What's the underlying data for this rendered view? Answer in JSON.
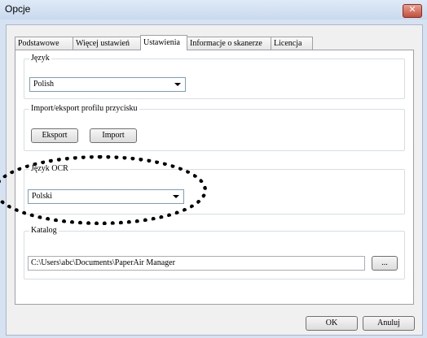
{
  "window": {
    "title": "Opcje"
  },
  "tabs": [
    "Podstawowe",
    "Więcej ustawień",
    "Ustawienia",
    "Informacje o skanerze",
    "Licencja"
  ],
  "active_tab": "Ustawienia",
  "language_group": {
    "title": "Język",
    "selected": "Polish"
  },
  "profile_group": {
    "title": "Import/eksport profilu przycisku",
    "export_label": "Eksport",
    "import_label": "Import"
  },
  "ocr_group": {
    "title": "Język OCR",
    "selected": "Polski"
  },
  "catalog_group": {
    "title": "Katalog",
    "path": "C:\\Users\\abc\\Documents\\PaperAir Manager",
    "browse_label": "..."
  },
  "footer": {
    "ok_label": "OK",
    "cancel_label": "Anuluj"
  },
  "icons": {
    "close": "close-icon"
  }
}
